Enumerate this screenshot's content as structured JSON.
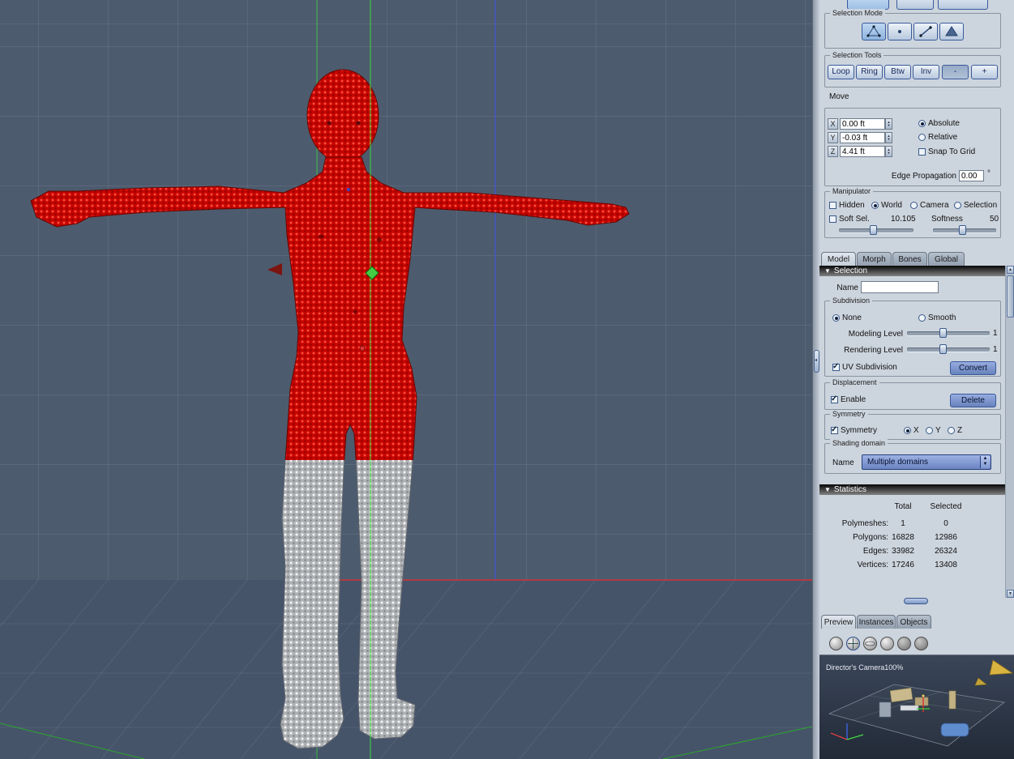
{
  "colors": {
    "accent_blue": "#5b79b8",
    "selection_red": "#d40400",
    "viewport_bg": "#4d5b6e"
  },
  "panel": {
    "selection_mode_title": "Selection Mode",
    "selection_tools_title": "Selection Tools",
    "tool_buttons": [
      "Loop",
      "Ring",
      "Btw",
      "Inv",
      "-",
      "+"
    ],
    "move": {
      "title": "Move",
      "rows": [
        {
          "axis": "X",
          "value": "0.00 ft"
        },
        {
          "axis": "Y",
          "value": "-0.03 ft"
        },
        {
          "axis": "Z",
          "value": "4.41 ft"
        }
      ],
      "absolute": "Absolute",
      "relative": "Relative",
      "snap_to_grid": "Snap To Grid",
      "edge_propagation_label": "Edge Propagation",
      "edge_propagation_value": "0.00",
      "edge_propagation_unit": "°"
    },
    "manipulator": {
      "title": "Manipulator",
      "hidden": "Hidden",
      "world": "World",
      "camera": "Camera",
      "selection": "Selection",
      "soft_sel": "Soft Sel.",
      "soft_sel_value": "10.105",
      "softness": "Softness",
      "softness_value": "50"
    },
    "tabs": [
      {
        "label": "Model"
      },
      {
        "label": "Morph"
      },
      {
        "label": "Bones"
      },
      {
        "label": "Global"
      }
    ],
    "selection_section": {
      "title": "Selection",
      "name_label": "Name",
      "name_value": "",
      "subdivision": {
        "title": "Subdivision",
        "none": "None",
        "smooth": "Smooth",
        "modeling_level": "Modeling Level",
        "modeling_value": "1",
        "rendering_level": "Rendering Level",
        "rendering_value": "1",
        "uv_subdivision": "UV Subdivision",
        "convert": "Convert"
      },
      "displacement": {
        "title": "Displacement",
        "enable": "Enable",
        "delete": "Delete"
      },
      "symmetry": {
        "title": "Symmetry",
        "label": "Symmetry",
        "x": "X",
        "y": "Y",
        "z": "Z"
      },
      "shading_domain": {
        "title": "Shading domain",
        "name_label": "Name",
        "value": "Multiple domains"
      }
    },
    "statistics": {
      "title": "Statistics",
      "col_total": "Total",
      "col_selected": "Selected",
      "rows": [
        {
          "label": "Polymeshes:",
          "total": "1",
          "selected": "0"
        },
        {
          "label": "Polygons:",
          "total": "16828",
          "selected": "12986"
        },
        {
          "label": "Edges:",
          "total": "33982",
          "selected": "26324"
        },
        {
          "label": "Vertices:",
          "total": "17246",
          "selected": "13408"
        }
      ]
    },
    "bottom_tabs": [
      {
        "label": "Preview"
      },
      {
        "label": "Instances"
      },
      {
        "label": "Objects"
      }
    ],
    "preview": {
      "camera_label": "Director's Camera",
      "zoom": "100%"
    }
  }
}
